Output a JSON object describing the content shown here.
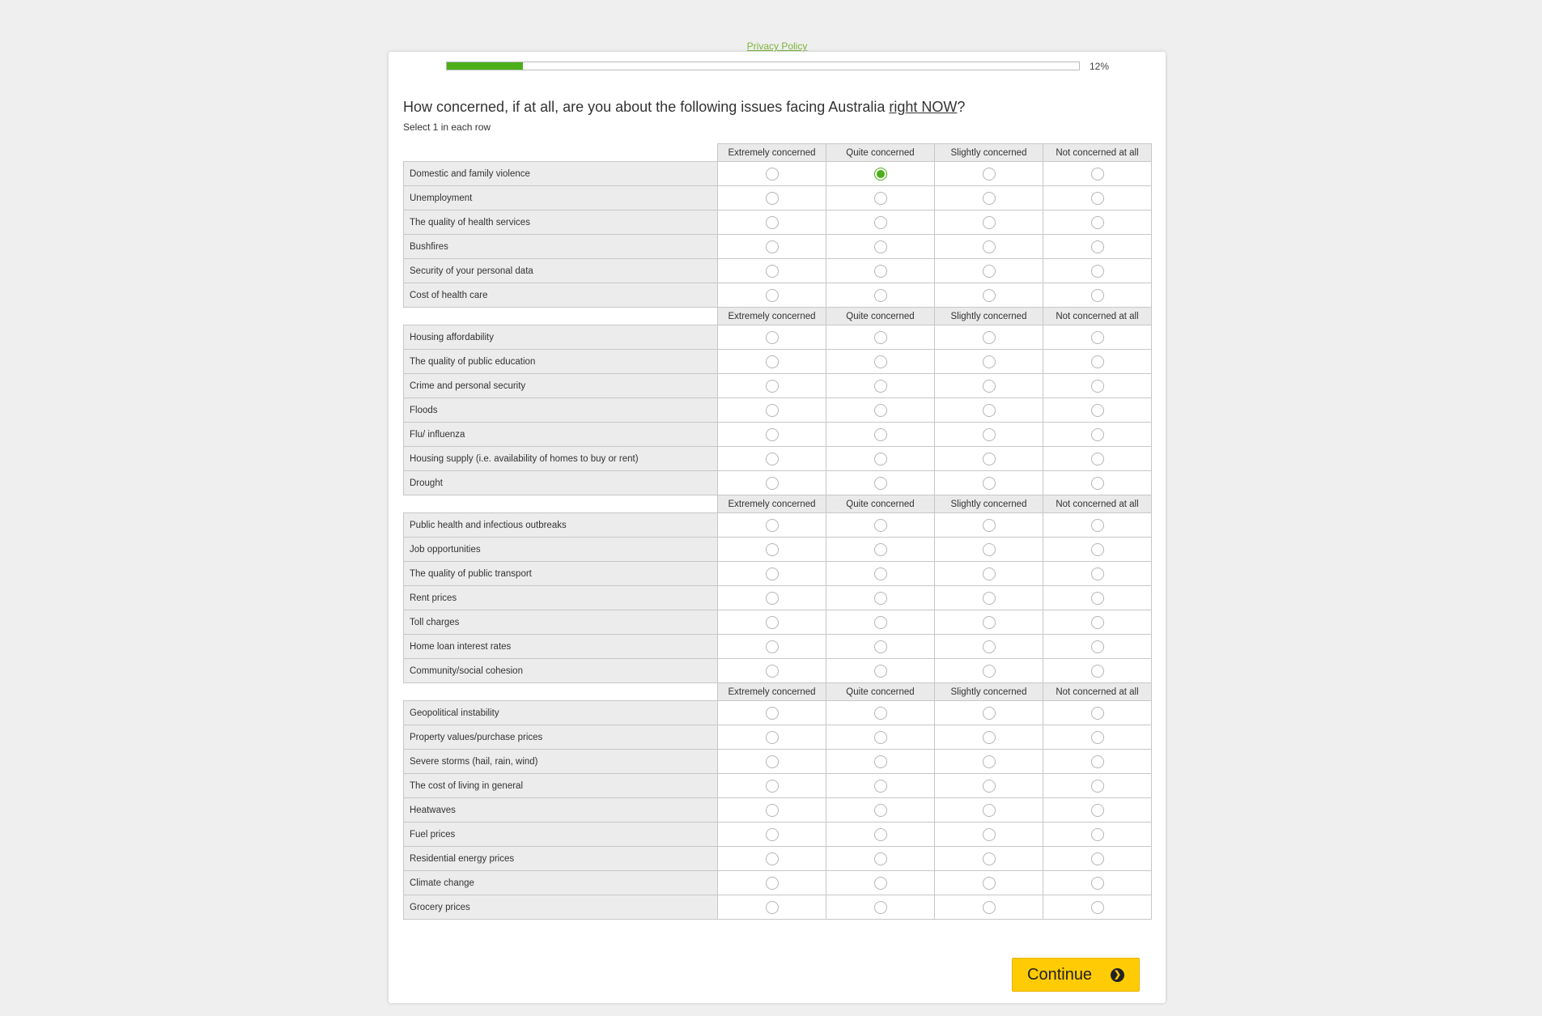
{
  "privacy_link": "Privacy Policy",
  "progress": {
    "value": 0.12,
    "label": "12%"
  },
  "question": {
    "text_before": "How concerned, if at all, are you about the following issues facing Australia ",
    "emphasis": "right NOW",
    "text_after": "?"
  },
  "instruction": "Select 1 in each row",
  "columns": [
    "Extremely concerned",
    "Quite concerned",
    "Slightly concerned",
    "Not concerned at all"
  ],
  "groups": [
    {
      "rows": [
        {
          "label": "Domestic and family violence",
          "selected": 1
        },
        {
          "label": "Unemployment",
          "selected": null
        },
        {
          "label": "The quality of health services",
          "selected": null
        },
        {
          "label": "Bushfires",
          "selected": null
        },
        {
          "label": "Security of your personal data",
          "selected": null
        },
        {
          "label": "Cost of health care",
          "selected": null
        }
      ]
    },
    {
      "rows": [
        {
          "label": "Housing affordability",
          "selected": null
        },
        {
          "label": "The quality of public education",
          "selected": null
        },
        {
          "label": "Crime and personal security",
          "selected": null
        },
        {
          "label": "Floods",
          "selected": null
        },
        {
          "label": "Flu/ influenza",
          "selected": null
        },
        {
          "label": "Housing supply (i.e. availability of homes to buy or rent)",
          "selected": null
        },
        {
          "label": "Drought",
          "selected": null
        }
      ]
    },
    {
      "rows": [
        {
          "label": "Public health and infectious outbreaks",
          "selected": null
        },
        {
          "label": "Job opportunities",
          "selected": null
        },
        {
          "label": "The quality of public transport",
          "selected": null
        },
        {
          "label": "Rent prices",
          "selected": null
        },
        {
          "label": "Toll charges",
          "selected": null
        },
        {
          "label": "Home loan interest rates",
          "selected": null
        },
        {
          "label": "Community/social cohesion",
          "selected": null
        }
      ]
    },
    {
      "rows": [
        {
          "label": "Geopolitical instability",
          "selected": null
        },
        {
          "label": "Property values/purchase prices",
          "selected": null
        },
        {
          "label": "Severe storms (hail, rain, wind)",
          "selected": null
        },
        {
          "label": "The cost of living in general",
          "selected": null
        },
        {
          "label": "Heatwaves",
          "selected": null
        },
        {
          "label": "Fuel prices",
          "selected": null
        },
        {
          "label": "Residential energy prices",
          "selected": null
        },
        {
          "label": "Climate change",
          "selected": null
        },
        {
          "label": "Grocery prices",
          "selected": null
        }
      ]
    }
  ],
  "continue_button": {
    "label": "Continue",
    "icon": "chevron-right-circle-icon"
  },
  "colors": {
    "accent_green": "#4caf1a",
    "button_yellow": "#ffcb05",
    "link_green": "#7ab43c"
  }
}
